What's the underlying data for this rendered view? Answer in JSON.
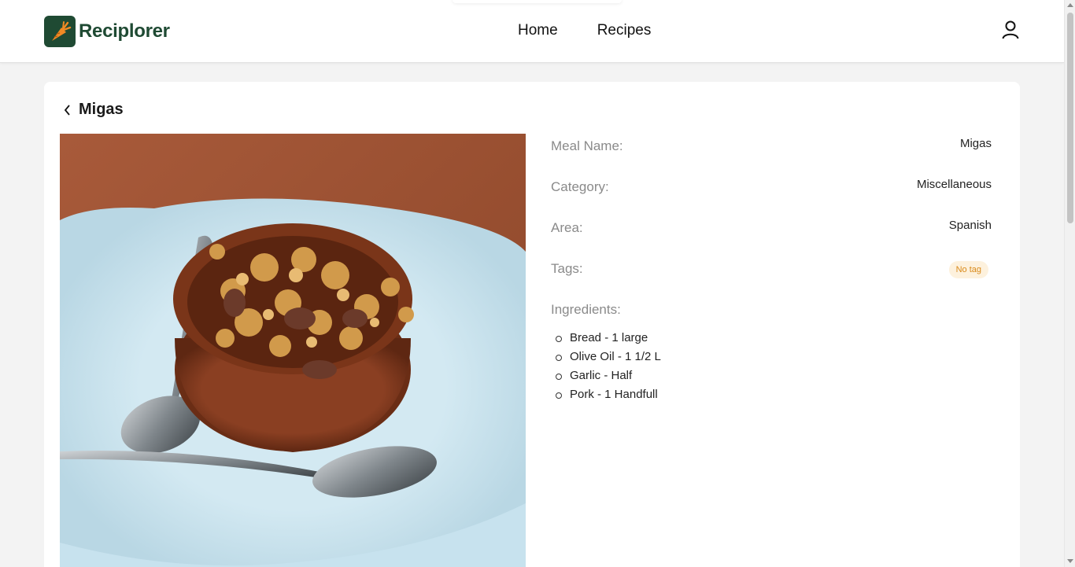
{
  "header": {
    "brand": "Reciplorer",
    "nav": [
      {
        "label": "Home"
      },
      {
        "label": "Recipes"
      }
    ],
    "user_icon": "user-icon",
    "logo_icon": "carrot-icon"
  },
  "page": {
    "title": "Migas",
    "back_icon": "chevron-left-icon"
  },
  "meal": {
    "image_alt": "Migas",
    "fields": {
      "name_label": "Meal Name:",
      "name_value": "Migas",
      "category_label": "Category:",
      "category_value": "Miscellaneous",
      "area_label": "Area:",
      "area_value": "Spanish",
      "tags_label": "Tags:",
      "tags_value": "No tag"
    },
    "ingredients_label": "Ingredients:",
    "ingredients": [
      "Bread - 1 large",
      "Olive Oil - 1 1/2 L",
      "Garlic - Half",
      "Pork - 1 Handfull"
    ]
  },
  "colors": {
    "brand": "#1f4a33",
    "logo_accent": "#f08a24",
    "tag_bg": "#fdf1dd",
    "tag_text": "#d98a1a"
  }
}
